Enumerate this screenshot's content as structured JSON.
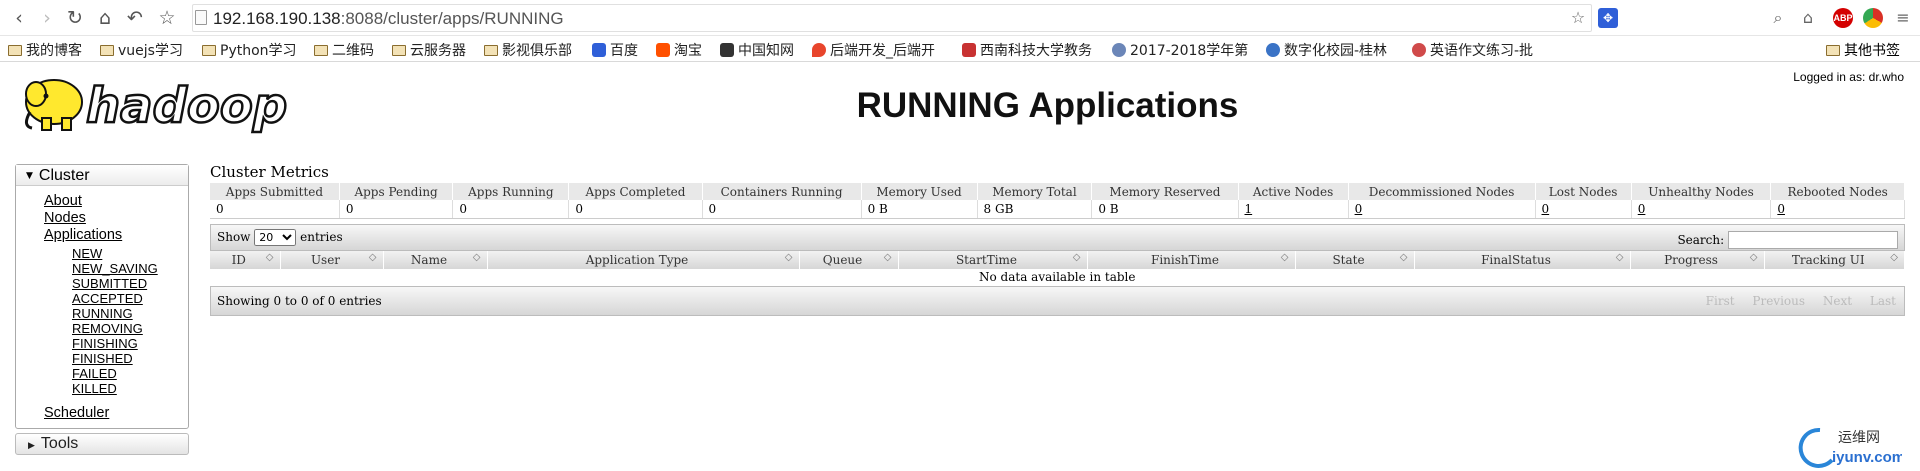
{
  "browser": {
    "url_host": "192.168.190.138",
    "url_rest": ":8088/cluster/apps/RUNNING",
    "bookmarks": [
      "我的博客",
      "vuejs学习",
      "Python学习",
      "二维码",
      "云服务器",
      "影视俱乐部",
      "百度",
      "淘宝",
      "中国知网",
      "后端开发_后端开",
      "西南科技大学教务",
      "2017-2018学年第",
      "数字化校园-桂林",
      "英语作文练习-批"
    ],
    "bookmarks_end": "其他书签"
  },
  "header": {
    "logged_in": "Logged in as: dr.who",
    "title": "RUNNING Applications",
    "logo_text": "hadoop"
  },
  "sidebar": {
    "cluster_label": "Cluster",
    "links": [
      "About",
      "Nodes",
      "Applications"
    ],
    "states": [
      "NEW",
      "NEW_SAVING",
      "SUBMITTED",
      "ACCEPTED",
      "RUNNING",
      "REMOVING",
      "FINISHING",
      "FINISHED",
      "FAILED",
      "KILLED"
    ],
    "scheduler": "Scheduler",
    "tools_label": "Tools"
  },
  "metrics": {
    "title": "Cluster Metrics",
    "headers": [
      "Apps Submitted",
      "Apps Pending",
      "Apps Running",
      "Apps Completed",
      "Containers Running",
      "Memory Used",
      "Memory Total",
      "Memory Reserved",
      "Active Nodes",
      "Decommissioned Nodes",
      "Lost Nodes",
      "Unhealthy Nodes",
      "Rebooted Nodes"
    ],
    "values": [
      "0",
      "0",
      "0",
      "0",
      "0",
      "0 B",
      "8 GB",
      "0 B",
      "1",
      "0",
      "0",
      "0",
      "0"
    ]
  },
  "apps_table": {
    "show_label": "Show",
    "entries_label": "entries",
    "page_size": "20",
    "search_label": "Search:",
    "columns": [
      "ID",
      "User",
      "Name",
      "Application Type",
      "Queue",
      "StartTime",
      "FinishTime",
      "State",
      "FinalStatus",
      "Progress",
      "Tracking UI"
    ],
    "empty_text": "No data available in table",
    "info_text": "Showing 0 to 0 of 0 entries",
    "pager": [
      "First",
      "Previous",
      "Next",
      "Last"
    ]
  },
  "watermark": {
    "line1": "运维网",
    "line2": "iyunv.com"
  }
}
